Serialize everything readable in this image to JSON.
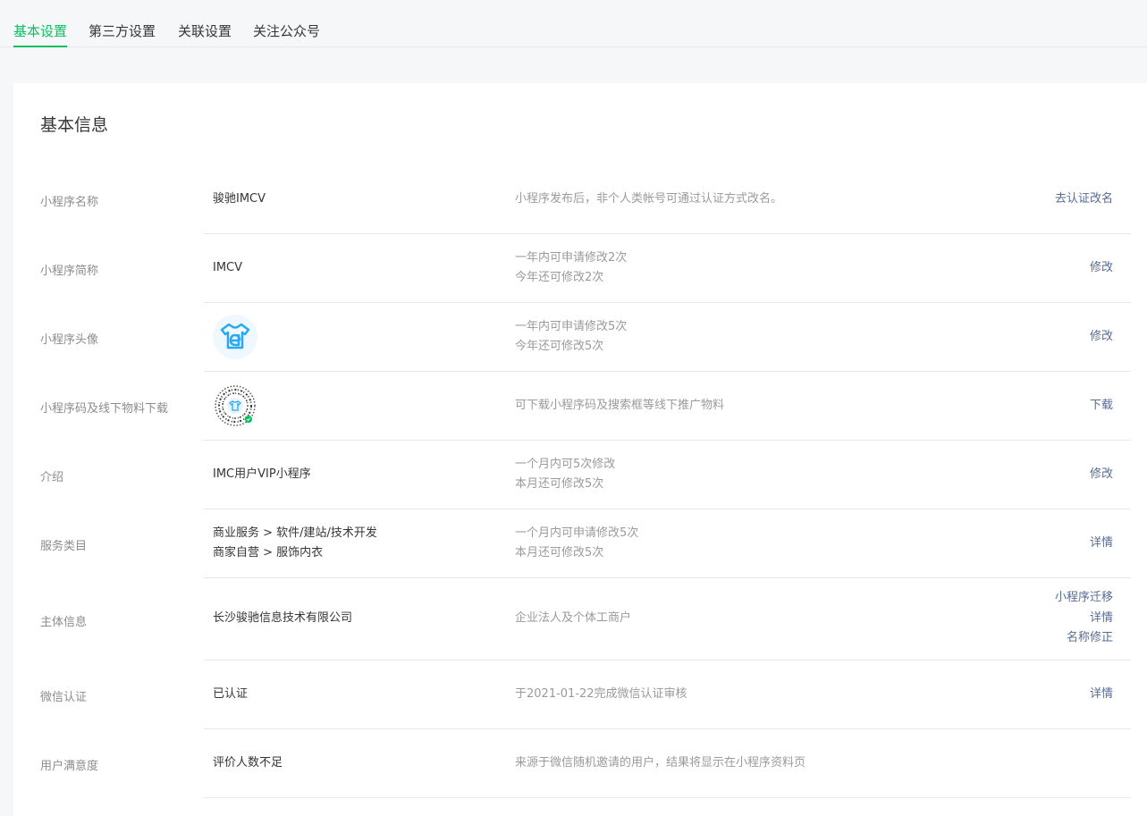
{
  "tabs": [
    {
      "label": "基本设置",
      "active": true
    },
    {
      "label": "第三方设置",
      "active": false
    },
    {
      "label": "关联设置",
      "active": false
    },
    {
      "label": "关注公众号",
      "active": false
    }
  ],
  "card": {
    "title": "基本信息",
    "rows": {
      "name": {
        "label": "小程序名称",
        "value": "骏驰IMCV",
        "desc": [
          "小程序发布后，非个人类帐号可通过认证方式改名。"
        ],
        "actions": [
          "去认证改名"
        ]
      },
      "short": {
        "label": "小程序简称",
        "value": "IMCV",
        "desc": [
          "一年内可申请修改2次",
          "今年还可修改2次"
        ],
        "actions": [
          "修改"
        ]
      },
      "avatar": {
        "label": "小程序头像",
        "icon": "tshirt-logo-icon",
        "desc": [
          "一年内可申请修改5次",
          "今年还可修改5次"
        ],
        "actions": [
          "修改"
        ]
      },
      "qrcode": {
        "label": "小程序码及线下物料下载",
        "icon": "mini-program-code-icon",
        "desc": [
          "可下载小程序码及搜索框等线下推广物料"
        ],
        "actions": [
          "下载"
        ]
      },
      "intro": {
        "label": "介绍",
        "value": "IMC用户VIP小程序",
        "desc": [
          "一个月内可5次修改",
          "本月还可修改5次"
        ],
        "actions": [
          "修改"
        ]
      },
      "category": {
        "label": "服务类目",
        "values": [
          "商业服务 > 软件/建站/技术开发",
          "商家自营 > 服饰内衣"
        ],
        "desc": [
          "一个月内可申请修改5次",
          "本月还可修改5次"
        ],
        "actions": [
          "详情"
        ]
      },
      "subject": {
        "label": "主体信息",
        "value": "长沙骏驰信息技术有限公司",
        "desc": [
          "企业法人及个体工商户"
        ],
        "actions": [
          "小程序迁移",
          "详情",
          "名称修正"
        ]
      },
      "verify": {
        "label": "微信认证",
        "value": "已认证",
        "desc": [
          "于2021-01-22完成微信认证审核"
        ],
        "actions": [
          "详情"
        ]
      },
      "satisfaction": {
        "label": "用户满意度",
        "value": "评价人数不足",
        "desc": [
          "来源于微信随机邀请的用户，结果将显示在小程序资料页"
        ],
        "actions": []
      }
    }
  },
  "colors": {
    "accent": "#07c160",
    "link": "#576b95",
    "icon_blue": "#29a9f2"
  }
}
